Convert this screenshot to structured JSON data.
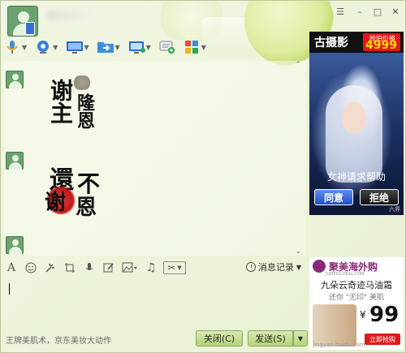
{
  "window": {
    "contact_name": "",
    "controls": {
      "skin": "☰",
      "minimize": "–",
      "maximize": "□",
      "close": "✕"
    }
  },
  "toolbar": {
    "items": [
      {
        "icon": "microphone-icon"
      },
      {
        "icon": "video-camera-icon"
      },
      {
        "icon": "screen-share-icon"
      },
      {
        "icon": "file-transfer-icon"
      },
      {
        "icon": "remote-desktop-icon"
      },
      {
        "icon": "message-add-icon"
      },
      {
        "icon": "apps-grid-icon"
      }
    ]
  },
  "chat": {
    "messages": [
      {
        "type": "sticker",
        "text_main": "谢主",
        "text_side": "隆恩"
      },
      {
        "type": "sticker",
        "text_main": "還",
        "text_side": "不",
        "text_stamp": "谢",
        "text_tail": "恩"
      }
    ]
  },
  "input_toolbar": {
    "icons": [
      "font-icon",
      "emoji-icon",
      "poke-icon",
      "screenshot-crop-icon",
      "voice-icon",
      "edit-icon",
      "image-icon",
      "music-icon",
      "scissors-icon"
    ],
    "history_label": "消息记录"
  },
  "footer": {
    "hint": "王牌美肌术，京东美妆大动作",
    "close_label": "关闭(C)",
    "send_label": "发送(S)",
    "send_caret": "▼"
  },
  "ads": {
    "top": {
      "brand": "古摄影",
      "price_label": "抢拍价格",
      "price": "4999",
      "caption": "女神请求帮助",
      "accept": "同意",
      "reject": "拒绝",
      "footer": "六界"
    },
    "bottom": {
      "brand": "聚美海外购",
      "sub": "JUMEIGLOBAL.COM",
      "title": "九朵云奇迹马油霜",
      "note": "还你 \"无印\" 美肌",
      "yen": "¥",
      "price": "99",
      "buy": "立即抢购",
      "url": "jingyan.baidu.com"
    }
  },
  "colors": {
    "accent_green": "#b5d27a",
    "ad_red": "#e8131a",
    "ad_purple": "#8b2a7a"
  }
}
